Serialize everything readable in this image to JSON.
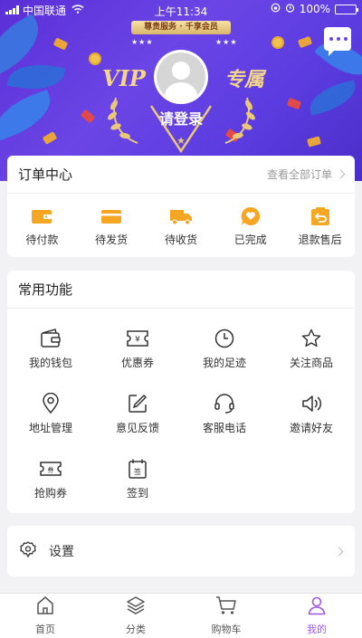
{
  "status_bar": {
    "carrier": "中国联通",
    "time": "上午11:34",
    "battery": "100%"
  },
  "header": {
    "ribbon": "尊贵服务 · 千享会员",
    "vip_left": "VIP",
    "vip_right": "专属",
    "login": "请登录"
  },
  "orders": {
    "title": "订单中心",
    "view_all": "查看全部订单",
    "items": [
      {
        "label": "待付款",
        "icon": "wallet-icon"
      },
      {
        "label": "待发货",
        "icon": "box-icon"
      },
      {
        "label": "待收货",
        "icon": "truck-icon"
      },
      {
        "label": "已完成",
        "icon": "heart-chat-icon"
      },
      {
        "label": "退款售后",
        "icon": "refund-icon"
      }
    ]
  },
  "functions": {
    "title": "常用功能",
    "items": [
      {
        "label": "我的钱包",
        "icon": "wallet-outline-icon"
      },
      {
        "label": "优惠券",
        "icon": "coupon-icon"
      },
      {
        "label": "我的足迹",
        "icon": "clock-icon"
      },
      {
        "label": "关注商品",
        "icon": "star-icon"
      },
      {
        "label": "地址管理",
        "icon": "location-icon"
      },
      {
        "label": "意见反馈",
        "icon": "edit-icon"
      },
      {
        "label": "客服电话",
        "icon": "headset-icon"
      },
      {
        "label": "邀请好友",
        "icon": "speaker-icon"
      },
      {
        "label": "抢购券",
        "icon": "ticket-icon"
      },
      {
        "label": "签到",
        "icon": "calendar-icon"
      }
    ]
  },
  "settings": {
    "label": "设置"
  },
  "tabbar": {
    "items": [
      {
        "label": "首页",
        "icon": "home-icon"
      },
      {
        "label": "分类",
        "icon": "layers-icon"
      },
      {
        "label": "购物车",
        "icon": "cart-icon"
      },
      {
        "label": "我的",
        "icon": "user-icon"
      }
    ],
    "active_color": "#9b59e6"
  },
  "colors": {
    "accent_orange": "#f5a623",
    "header_purple": "#6b45e6"
  }
}
